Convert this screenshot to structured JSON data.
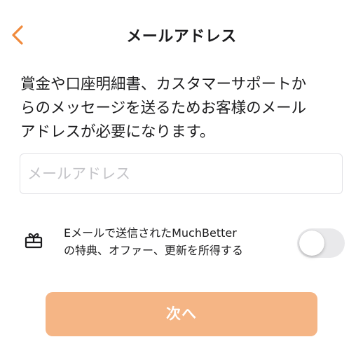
{
  "header": {
    "back_icon": "chevron-left-icon",
    "title": "メールアドレス"
  },
  "description": {
    "line1": "賞金や口座明細書、カスタマーサポートか",
    "line2": "らのメッセージを送るためお客様のメール",
    "line3": "アドレスが必要になります。"
  },
  "email_field": {
    "value": "",
    "placeholder": "メールアドレス"
  },
  "promo_optin": {
    "icon": "gift-icon",
    "line1": "Eメールで送信されたMuchBetter",
    "line2": "の特典、オファー、更新を所得する",
    "enabled": false
  },
  "next_button": {
    "label": "次へ"
  },
  "colors": {
    "accent": "#f08a3c",
    "button_disabled_bg": "#f5b585",
    "toggle_off_bg": "#e9e9eb",
    "field_border": "#e2e2e6",
    "placeholder": "#c4c4c8"
  }
}
